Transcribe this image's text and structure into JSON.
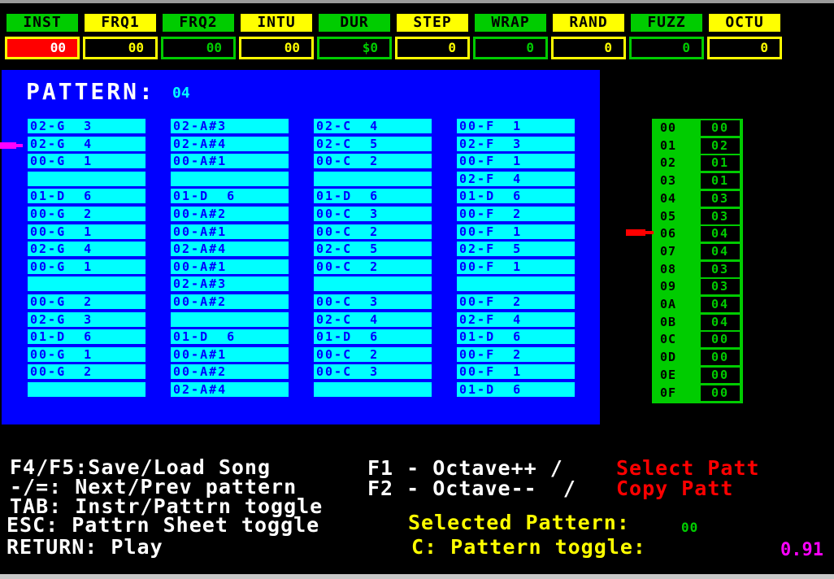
{
  "params": {
    "headers": [
      "INST",
      "FRQ1",
      "FRQ2",
      "INTU",
      "DUR",
      "STEP",
      "WRAP",
      "RAND",
      "FUZZ",
      "OCTU"
    ],
    "values": [
      "00",
      "00",
      "00",
      "00",
      "$0",
      "0",
      "0",
      "0",
      "0",
      "0"
    ]
  },
  "pattern": {
    "title": "PATTERN:",
    "number": "04",
    "columns": [
      [
        "02-G  3",
        "02-G  4",
        "00-G  1",
        "",
        "01-D  6",
        "00-G  2",
        "00-G  1",
        "02-G  4",
        "00-G  1",
        "",
        "00-G  2",
        "02-G  3",
        "01-D  6",
        "00-G  1",
        "00-G  2",
        ""
      ],
      [
        "02-A#3",
        "02-A#4",
        "00-A#1",
        "",
        "01-D  6",
        "00-A#2",
        "00-A#1",
        "02-A#4",
        "00-A#1",
        "02-A#3",
        "00-A#2",
        "",
        "01-D  6",
        "00-A#1",
        "00-A#2",
        "02-A#4"
      ],
      [
        "02-C  4",
        "02-C  5",
        "00-C  2",
        "",
        "01-D  6",
        "00-C  3",
        "00-C  2",
        "02-C  5",
        "00-C  2",
        "",
        "00-C  3",
        "02-C  4",
        "01-D  6",
        "00-C  2",
        "00-C  3",
        ""
      ],
      [
        "00-F  1",
        "02-F  3",
        "00-F  1",
        "02-F  4",
        "01-D  6",
        "00-F  2",
        "00-F  1",
        "02-F  5",
        "00-F  1",
        "",
        "00-F  2",
        "02-F  4",
        "01-D  6",
        "00-F  2",
        "00-F  1",
        "01-D  6"
      ]
    ]
  },
  "orders": {
    "labels": [
      "00",
      "01",
      "02",
      "03",
      "04",
      "05",
      "06",
      "07",
      "08",
      "09",
      "0A",
      "0B",
      "0C",
      "0D",
      "0E",
      "0F"
    ],
    "values": [
      "00",
      "02",
      "01",
      "01",
      "03",
      "03",
      "04",
      "04",
      "03",
      "03",
      "04",
      "04",
      "00",
      "00",
      "00",
      "00"
    ]
  },
  "help": {
    "save_load": "F4/F5:Save/Load Song",
    "next_prev": "-/=: Next/Prev pattern",
    "tab": "TAB: Instr/Pattrn toggle",
    "esc": "ESC: Pattrn Sheet toggle",
    "return": "RETURN: Play",
    "f1": "F1 - Octave++ /",
    "f1_action": "Select Patt",
    "f2": "F2 - Octave--  /",
    "f2_action": "Copy Patt",
    "selected_label": "Selected Pattern:",
    "selected_value": "00",
    "c_toggle": "C: Pattern toggle:"
  },
  "version": "0.91",
  "colors": {
    "header_green": "#00cc00",
    "header_yellow": "#ffff00",
    "panel_blue": "#0000ff",
    "cell_cyan": "#00ffff",
    "accent_red": "#ff0000",
    "pointer_magenta": "#ff00ff"
  }
}
